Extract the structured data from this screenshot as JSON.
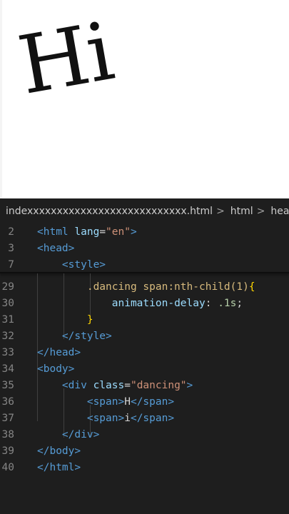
{
  "preview": {
    "text": "Hi"
  },
  "breadcrumb": {
    "file": "indexxxxxxxxxxxxxxxxxxxxxxxxxxx.html",
    "item1": "html",
    "item2": "head"
  },
  "sticky": [
    {
      "ln": "2",
      "indent": "",
      "parts": [
        [
          "tag",
          "<html "
        ],
        [
          "attr",
          "lang"
        ],
        [
          "txt",
          "="
        ],
        [
          "str",
          "\"en\""
        ],
        [
          "tag",
          ">"
        ]
      ]
    },
    {
      "ln": "3",
      "indent": "",
      "parts": [
        [
          "tag",
          "<head>"
        ]
      ]
    },
    {
      "ln": "7",
      "indent": "    ",
      "parts": [
        [
          "tag",
          "<style>"
        ]
      ]
    }
  ],
  "lines": [
    {
      "ln": "29",
      "indent": "        ",
      "parts": [
        [
          "sel",
          ".dancing span:nth-child(1)"
        ],
        [
          "brace",
          "{"
        ]
      ]
    },
    {
      "ln": "30",
      "indent": "            ",
      "parts": [
        [
          "prop",
          "animation-delay"
        ],
        [
          "txt",
          ": "
        ],
        [
          "num",
          ".1s"
        ],
        [
          "txt",
          ";"
        ]
      ]
    },
    {
      "ln": "31",
      "indent": "        ",
      "parts": [
        [
          "brace",
          "}"
        ]
      ]
    },
    {
      "ln": "32",
      "indent": "    ",
      "parts": [
        [
          "tag",
          "</style>"
        ]
      ]
    },
    {
      "ln": "33",
      "indent": "",
      "parts": [
        [
          "tag",
          "</head>"
        ]
      ]
    },
    {
      "ln": "34",
      "indent": "",
      "parts": [
        [
          "tag",
          "<body>"
        ]
      ]
    },
    {
      "ln": "35",
      "indent": "    ",
      "parts": [
        [
          "tag",
          "<div "
        ],
        [
          "attr",
          "class"
        ],
        [
          "txt",
          "="
        ],
        [
          "str",
          "\"dancing\""
        ],
        [
          "tag",
          ">"
        ]
      ]
    },
    {
      "ln": "36",
      "indent": "        ",
      "parts": [
        [
          "tag",
          "<span>"
        ],
        [
          "txt",
          "H"
        ],
        [
          "tag",
          "</span>"
        ]
      ]
    },
    {
      "ln": "37",
      "indent": "        ",
      "parts": [
        [
          "tag",
          "<span>"
        ],
        [
          "txt",
          "i"
        ],
        [
          "tag",
          "</span>"
        ]
      ]
    },
    {
      "ln": "38",
      "indent": "    ",
      "parts": [
        [
          "tag",
          "</div>"
        ]
      ]
    },
    {
      "ln": "39",
      "indent": "",
      "parts": [
        [
          "tag",
          "</body>"
        ]
      ]
    },
    {
      "ln": "40",
      "indent": "",
      "parts": [
        [
          "tag",
          "</html>"
        ]
      ]
    }
  ],
  "colors": {
    "editor_bg": "#1e1e1e",
    "tag": "#569cd6",
    "attr": "#9cdcfe",
    "string": "#ce9178",
    "number": "#b5cea8",
    "selector": "#d7ba7d",
    "bracket": "#ffd700"
  }
}
